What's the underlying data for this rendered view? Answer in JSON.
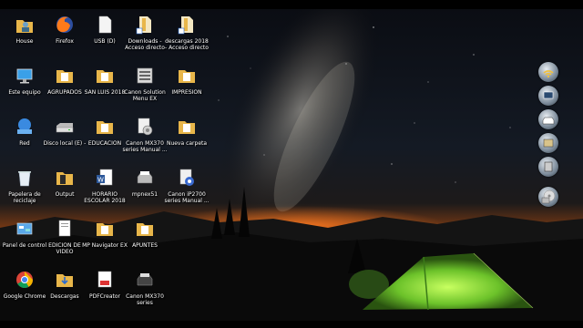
{
  "icons": [
    {
      "label": "House",
      "name": "house-icon"
    },
    {
      "label": "Firefox",
      "name": "firefox-icon"
    },
    {
      "label": "USB (D)",
      "name": "usb-drive-icon"
    },
    {
      "label": "Downloads - Acceso directo",
      "name": "downloads-shortcut-icon"
    },
    {
      "label": "descargas 2018 - Acceso directo",
      "name": "descargas-2018-shortcut-icon"
    },
    {
      "label": "Este equipo",
      "name": "este-equipo-icon"
    },
    {
      "label": "AGRUPADOS",
      "name": "agrupados-folder-icon"
    },
    {
      "label": "SAN LUIS 2018",
      "name": "san-luis-folder-icon"
    },
    {
      "label": "Canon Solution Menu EX",
      "name": "canon-solution-menu-icon"
    },
    {
      "label": "IMPRESION",
      "name": "impresion-folder-icon"
    },
    {
      "label": "Red",
      "name": "red-network-icon"
    },
    {
      "label": "Disco local (E) -",
      "name": "disco-local-icon"
    },
    {
      "label": "EDUCACION",
      "name": "educacion-folder-icon"
    },
    {
      "label": "Canon MX370 series Manual ...",
      "name": "canon-mx370-manual-icon"
    },
    {
      "label": "Nueva carpeta",
      "name": "nueva-carpeta-icon"
    },
    {
      "label": "Papelera de reciclaje",
      "name": "recycle-bin-icon"
    },
    {
      "label": "Output",
      "name": "output-folder-icon"
    },
    {
      "label": "HORARIO ESCOLAR 2018",
      "name": "horario-word-doc-icon"
    },
    {
      "label": "mpnex51",
      "name": "mpnex51-icon"
    },
    {
      "label": "Canon iP2700 series Manual ...",
      "name": "canon-ip2700-manual-icon"
    },
    {
      "label": "Panel de control",
      "name": "control-panel-icon"
    },
    {
      "label": "EDICION DE VIDEO",
      "name": "edicion-video-icon"
    },
    {
      "label": "MP Navigator EX",
      "name": "mp-navigator-icon"
    },
    {
      "label": "APUNTES",
      "name": "apuntes-folder-icon"
    },
    {
      "label": "Google Chrome",
      "name": "chrome-icon"
    },
    {
      "label": "Descargas",
      "name": "descargas-folder-icon"
    },
    {
      "label": "PDFCreator",
      "name": "pdfcreator-icon"
    },
    {
      "label": "Canon MX370 series",
      "name": "canon-mx370-printer-icon"
    }
  ],
  "gadgets": [
    {
      "name": "wifi-gadget-icon"
    },
    {
      "name": "display-gadget-icon"
    },
    {
      "name": "printer-gadget-icon"
    },
    {
      "name": "scanner-gadget-icon"
    },
    {
      "name": "calculator-gadget-icon"
    },
    {
      "name": "cd-gadget-icon"
    }
  ],
  "colors": {
    "folder": "#e8b64a",
    "tent": "#7fd23a",
    "horizon": "#e0641c"
  }
}
